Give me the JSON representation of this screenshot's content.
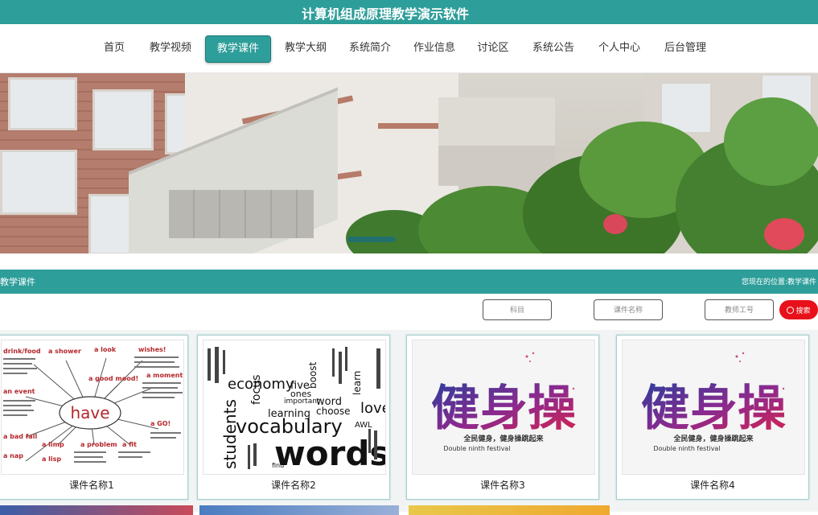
{
  "header": {
    "title": "计算机组成原理教学演示软件"
  },
  "nav": {
    "items": [
      "首页",
      "教学视频",
      "教学课件",
      "教学大纲",
      "系统简介",
      "作业信息",
      "讨论区",
      "系统公告",
      "个人中心",
      "后台管理"
    ],
    "active": "教学课件"
  },
  "section": {
    "title": "教学课件",
    "breadcrumb_prefix": "您现在的位置:",
    "breadcrumb_current": "教学课件"
  },
  "filters": {
    "subject_placeholder": "科目",
    "name_placeholder": "课件名称",
    "teacher_placeholder": "教师工号",
    "search_label": "搜索"
  },
  "cards": [
    {
      "name": "课件名称1",
      "thumb_words": [
        "drink/food",
        "a shower",
        "a look",
        "wishes!",
        "a good mood!",
        "a moment",
        "have",
        "an event",
        "a bad fall",
        "a limp",
        "a problem",
        "a fit",
        "a GO!",
        "a nap",
        "a lisp"
      ]
    },
    {
      "name": "课件名称2",
      "thumb_words": [
        "economy",
        "focus",
        "vocabulary",
        "words",
        "students",
        "learning",
        "choose",
        "love",
        "learn",
        "important",
        "word",
        "five",
        "ones",
        "boost",
        "AWL",
        "find"
      ]
    },
    {
      "name": "课件名称3",
      "thumb_words": [
        "健身操",
        "全民健身，健身操跳起来",
        "Double ninth festival"
      ]
    },
    {
      "name": "课件名称4",
      "thumb_words": [
        "健身操",
        "全民健身，健身操跳起来",
        "Double ninth festival"
      ]
    }
  ],
  "colors": {
    "primary": "#2e9e9a",
    "search": "#e8101a"
  }
}
